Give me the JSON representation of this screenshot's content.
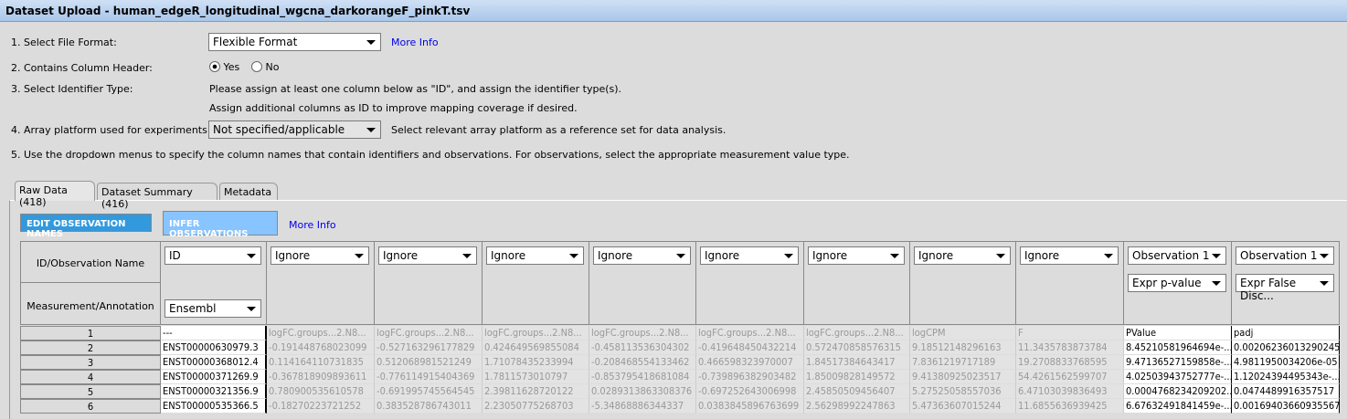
{
  "title": "Dataset Upload - human_edgeR_longitudinal_wgcna_darkorangeF_pinkT.tsv",
  "form": {
    "file_format_label": "1. Select File Format:",
    "file_format_value": "Flexible Format",
    "more_info": "More Info",
    "header_label": "2. Contains Column Header:",
    "yes": "Yes",
    "no": "No",
    "header_selected": "Yes",
    "identifier_label": "3. Select Identifier Type:",
    "identifier_help1": "Please assign at least one column below as \"ID\", and assign the identifier type(s).",
    "identifier_help2": "Assign additional columns as ID to improve mapping coverage if desired.",
    "platform_label": "4. Array platform used for experiments:",
    "platform_value": "Not specified/applicable",
    "platform_help": "Select relevant array platform as a reference set for data analysis.",
    "step5": "5. Use the dropdown menus to specify the column names that contain identifiers and observations. For observations, select the appropriate measurement value type."
  },
  "tabs": [
    "Raw Data (418)",
    "Dataset Summary (416)",
    "Metadata"
  ],
  "buttons": {
    "edit": "EDIT OBSERVATION NAMES",
    "infer": "INFER OBSERVATIONS",
    "more_info": "More Info"
  },
  "grid": {
    "row_header1": "ID/Observation Name",
    "row_header2": "Measurement/Annotation",
    "columns": [
      {
        "type": "ID",
        "measure": "Ensembl",
        "kind": "id"
      },
      {
        "type": "Ignore",
        "kind": "ign"
      },
      {
        "type": "Ignore",
        "kind": "ign"
      },
      {
        "type": "Ignore",
        "kind": "ign"
      },
      {
        "type": "Ignore",
        "kind": "ign"
      },
      {
        "type": "Ignore",
        "kind": "ign"
      },
      {
        "type": "Ignore",
        "kind": "ign"
      },
      {
        "type": "Ignore",
        "kind": "ign"
      },
      {
        "type": "Ignore",
        "kind": "ign"
      },
      {
        "type": "Observation 1",
        "measure": "Expr p-value",
        "kind": "obs"
      },
      {
        "type": "Observation 1",
        "measure": "Expr False Disc...",
        "kind": "obs"
      }
    ],
    "rows": [
      {
        "n": "1",
        "cells": [
          "---",
          "logFC.groups...2.N8...",
          "logFC.groups...2.N8...",
          "logFC.groups...2.N8...",
          "logFC.groups...2.N8...",
          "logFC.groups...2.N8...",
          "logFC.groups...2.N8...",
          "logCPM",
          "F",
          "PValue",
          "padj"
        ]
      },
      {
        "n": "2",
        "cells": [
          "ENST00000630979.3",
          "-0.191448768023099",
          "-0.527163296177829",
          "0.424649569855084",
          "-0.458113536304302",
          "-0.419648450432214",
          "0.572470858576315",
          "9.18512148296163",
          "11.3435783873784",
          "8.45210581964694e-...",
          "0.00206236013290245"
        ]
      },
      {
        "n": "3",
        "cells": [
          "ENST00000368012.4",
          "0.114164110731835",
          "0.512068981521249",
          "1.71078435233994",
          "-0.208468554133462",
          "0.466598323970007",
          "1.84517384643417",
          "7.8361219717189",
          "19.2708833768595",
          "9.47136527159858e-...",
          "4.9811950034206e-05"
        ]
      },
      {
        "n": "4",
        "cells": [
          "ENST00000371269.9",
          "-0.367818909893611",
          "-0.776114915404369",
          "1.7811573010797",
          "-0.853795418681084",
          "-0.739896382903482",
          "1.85009828149572",
          "9.41380925023517",
          "54.4261562599707",
          "4.02503943752777e-...",
          "1.12024394495343e-..."
        ]
      },
      {
        "n": "5",
        "cells": [
          "ENST00000321356.9",
          "0.780900535610578",
          "-0.691995745564545",
          "2.39811628720122",
          "0.0289313863308376",
          "-0.697252643006998",
          "2.45850509456407",
          "5.27525058557036",
          "6.47103039836493",
          "0.0004768234209202...",
          "0.0474489916357517"
        ]
      },
      {
        "n": "6",
        "cells": [
          "ENST00000535366.5",
          "-0.18270223721252",
          "0.383528786743011",
          "2.23050775268703",
          "-5.34868886344337",
          "0.0383845896763699",
          "2.56298992247863",
          "5.47363607015244",
          "11.6855636939425",
          "6.67632491841459e-...",
          "0.00169403660935567"
        ]
      }
    ]
  }
}
